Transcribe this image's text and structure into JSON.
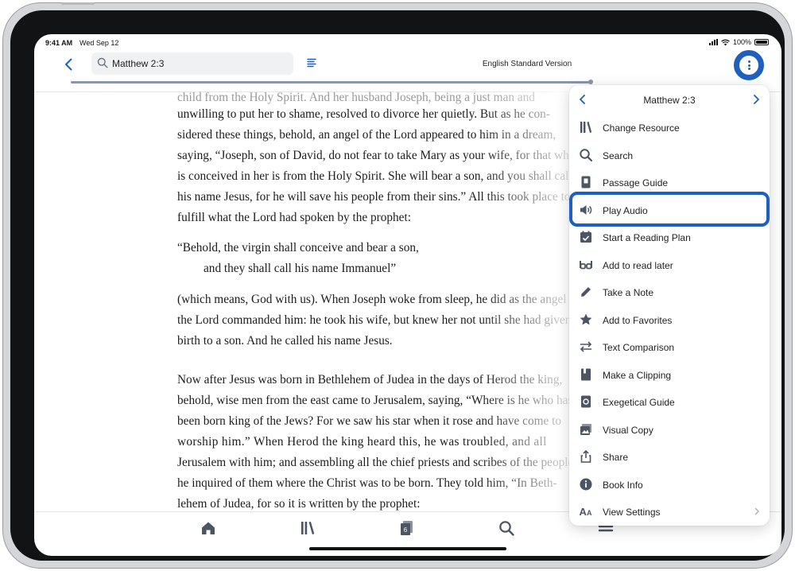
{
  "status_bar": {
    "time": "9:41 AM",
    "date": "Wed Sep 12",
    "battery": "100%"
  },
  "toolbar": {
    "reference": "Matthew 2:3",
    "version": "English Standard Version"
  },
  "reader": {
    "lines": [
      "unwilling to put her to shame, resolved to divorce her quietly. But as he con-",
      "sidered these things, behold, an angel of the Lord appeared to him in a dream,",
      "saying, “Joseph, son of David, do not fear to take Mary as your wife, for that which",
      "is conceived in her is from the Holy Spirit. She will bear a son, and you shall call",
      "his name Jesus, for he will save his people from their sins.” All this took place to",
      "fulfill what the Lord had spoken by the prophet:",
      "“Behold, the virgin shall conceive and bear a son,",
      "and they shall call his name Immanuel”",
      "(which means, God with us). When Joseph woke from sleep, he did as the angel of",
      "the Lord commanded him: he took his wife, but knew her not until she had given",
      "birth to a son. And he called his name Jesus.",
      "Now after Jesus was born in Bethlehem of Judea in the days of Herod the king,",
      "behold, wise men from the east came to Jerusalem, saying, “Where is he who has",
      "been born king of the Jews? For we saw his star when it rose and have come to",
      "worship him.” When Herod the king heard this, he was troubled, and all",
      "Jerusalem with him; and assembling all the chief priests and scribes of the people,",
      "he inquired of them where the Christ was to be born. They told him, “In Beth-",
      "lehem of Judea, for so it is written by the prophet:"
    ]
  },
  "menu": {
    "title": "Matthew 2:3",
    "items": [
      {
        "label": "Change Resource",
        "icon": "library-icon"
      },
      {
        "label": "Search",
        "icon": "search-icon"
      },
      {
        "label": "Passage Guide",
        "icon": "passage-guide-icon"
      },
      {
        "label": "Play Audio",
        "icon": "speaker-icon"
      },
      {
        "label": "Start a Reading Plan",
        "icon": "calendar-check-icon"
      },
      {
        "label": "Add to read later",
        "icon": "glasses-icon"
      },
      {
        "label": "Take a Note",
        "icon": "pencil-icon"
      },
      {
        "label": "Add to Favorites",
        "icon": "star-icon"
      },
      {
        "label": "Text Comparison",
        "icon": "compare-arrows-icon"
      },
      {
        "label": "Make a Clipping",
        "icon": "clipping-icon"
      },
      {
        "label": "Exegetical Guide",
        "icon": "exegetical-guide-icon"
      },
      {
        "label": "Visual Copy",
        "icon": "visual-copy-icon"
      },
      {
        "label": "Share",
        "icon": "share-icon"
      },
      {
        "label": "Book Info",
        "icon": "info-icon"
      },
      {
        "label": "View Settings",
        "icon": "text-size-icon"
      }
    ]
  },
  "tabbar": {
    "documents_count": "6"
  },
  "colors": {
    "accent": "#1f5fbf",
    "icon": "#4b5563"
  }
}
